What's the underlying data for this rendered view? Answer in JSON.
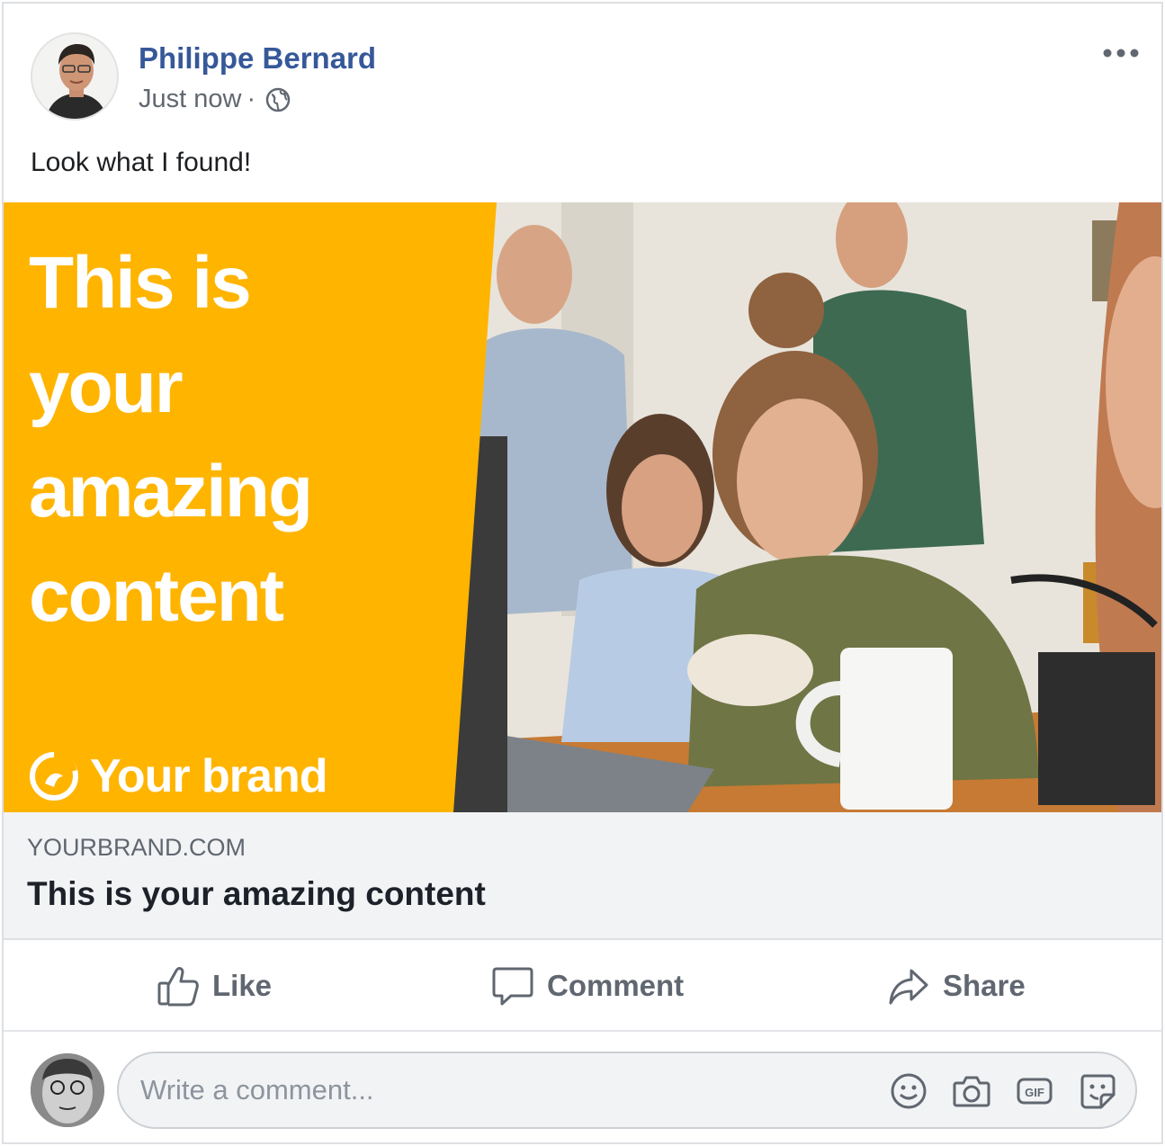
{
  "post": {
    "author": "Philippe Bernard",
    "time": "Just now",
    "separator": "·",
    "text": "Look what I found!"
  },
  "media": {
    "headline": "This is\nyour\namazing\ncontent",
    "brand_name": "Your brand",
    "accent_color": "#ffb400"
  },
  "link": {
    "domain": "YOURBRAND.COM",
    "title": "This is your amazing content"
  },
  "actions": {
    "like": "Like",
    "comment": "Comment",
    "share": "Share"
  },
  "comment_box": {
    "placeholder": "Write a comment...",
    "icons": [
      "emoji-icon",
      "camera-icon",
      "gif-icon",
      "sticker-icon"
    ]
  },
  "colors": {
    "author_link": "#365899",
    "meta_text": "#616770",
    "action_text": "#606770"
  }
}
